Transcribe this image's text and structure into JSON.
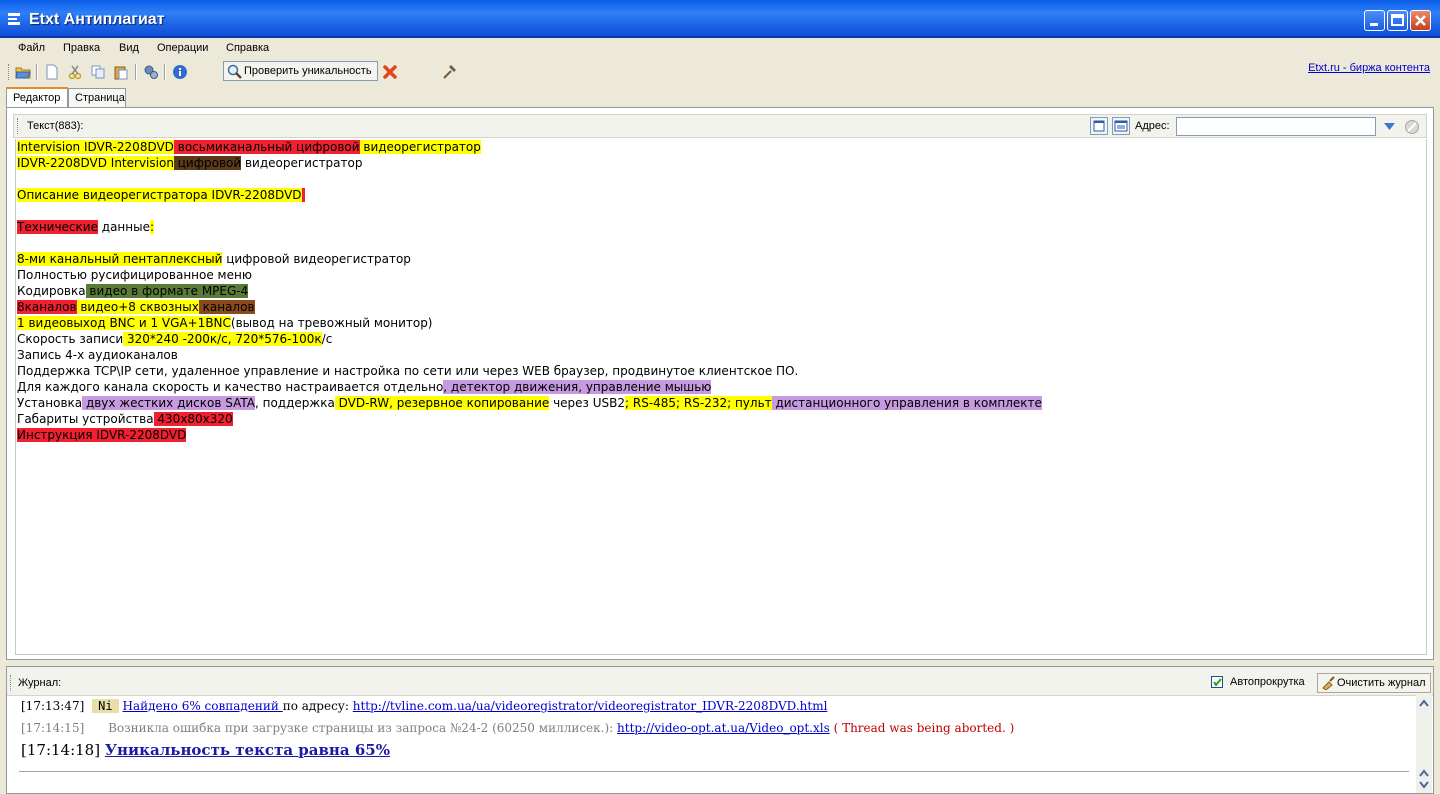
{
  "window": {
    "title": "Etxt Антиплагиат"
  },
  "menu": [
    "Файл",
    "Правка",
    "Вид",
    "Операции",
    "Справка"
  ],
  "toolbar": {
    "check_label": "Проверить уникальность",
    "link_label": "Etxt.ru - биржа контента"
  },
  "tabs": [
    "Редактор",
    "Страница"
  ],
  "editor": {
    "text_label": "Текст(883):",
    "address_label": "Адрес:",
    "address_value": "",
    "colors": {
      "yellow": "#FFFF00",
      "red": "#F02030",
      "brown": "#8B4A1C",
      "darkbrown": "#5A3A18",
      "green": "#5A7A38",
      "violet": "#C79AE0"
    },
    "lines": [
      [
        {
          "t": "Intervision IDVR-2208DVD",
          "c": "yellow"
        },
        {
          "t": " восьмиканальный цифровой",
          "c": "red"
        },
        {
          "t": " видеорегистратор",
          "c": "yellow"
        }
      ],
      [
        {
          "t": "IDVR-2208DVD Intervision",
          "c": "yellow"
        },
        {
          "t": " цифровой",
          "c": "darkbrown"
        },
        {
          "t": " видеорегистратор",
          "c": ""
        }
      ],
      [],
      [
        {
          "t": "Описание видеорегистратора IDVR-2208DVD",
          "c": "yellow"
        },
        {
          "t": " ",
          "c": "red"
        }
      ],
      [],
      [
        {
          "t": "Технические",
          "c": "red"
        },
        {
          "t": " данные",
          "c": ""
        },
        {
          "t": ":",
          "c": "yellow"
        }
      ],
      [],
      [
        {
          "t": "8-ми канальный пентаплексный",
          "c": "yellow"
        },
        {
          "t": " цифровой видеорегистратор",
          "c": ""
        }
      ],
      [
        {
          "t": "Полностью русифицированное меню",
          "c": ""
        }
      ],
      [
        {
          "t": "Кодировка",
          "c": ""
        },
        {
          "t": " видео в формате MPEG-4",
          "c": "green"
        }
      ],
      [
        {
          "t": "8каналов",
          "c": "red"
        },
        {
          "t": " видео+8 сквозных",
          "c": "yellow"
        },
        {
          "t": " каналов",
          "c": "brown"
        }
      ],
      [
        {
          "t": "1 видеовыход BNC и 1 VGA+1BNC",
          "c": "yellow"
        },
        {
          "t": "(вывод на тревожный монитор)",
          "c": ""
        }
      ],
      [
        {
          "t": "Скорость записи",
          "c": ""
        },
        {
          "t": " 320*240 -200к/с, 720*576-100к",
          "c": "yellow"
        },
        {
          "t": "/с",
          "c": ""
        }
      ],
      [
        {
          "t": "Запись 4-х аудиоканалов",
          "c": ""
        }
      ],
      [
        {
          "t": "Поддержка TCP\\IP сети, удаленное управление и настройка по сети или через WEB браузер, продвинутое клиентское ПО.",
          "c": ""
        }
      ],
      [
        {
          "t": "Для каждого канала скорость и качество настраивается отдельно",
          "c": ""
        },
        {
          "t": ", детектор движения, управление мышью",
          "c": "violet"
        }
      ],
      [
        {
          "t": "Установка",
          "c": ""
        },
        {
          "t": " двух жестких дисков SATA",
          "c": "violet"
        },
        {
          "t": ", поддержка",
          "c": ""
        },
        {
          "t": " DVD-RW, резервное копирование",
          "c": "yellow"
        },
        {
          "t": " через USB2",
          "c": ""
        },
        {
          "t": "; RS-485; RS-232; пульт",
          "c": "yellow"
        },
        {
          "t": " дистанционного управления в комплекте",
          "c": "violet"
        }
      ],
      [
        {
          "t": "Габариты устройства",
          "c": ""
        },
        {
          "t": " 430х80х320",
          "c": "red"
        }
      ],
      [
        {
          "t": "Инструкция IDVR-2208DVD",
          "c": "red"
        }
      ]
    ]
  },
  "journal": {
    "label": "Журнал:",
    "autoscroll_label": "Автопрокрутка",
    "autoscroll_checked": true,
    "clear_label": "Очистить журнал",
    "entries": [
      {
        "time": "[17:13:47]",
        "badge": "Ni",
        "link_text": "Найдено 6% совпадений ",
        "middle": "по адресу: ",
        "url": "http://tvline.com.ua/ua/videoregistrator/videoregistrator_IDVR-2208DVD.html"
      },
      {
        "time": "[17:14:15]",
        "message": "Возникла ошибка при загрузке страницы из запроса №24-2 (60250 миллисек.):",
        "url": "http://video-opt.at.ua/Video_opt.xls",
        "error": "( Thread was being aborted. )"
      },
      {
        "time": "[17:14:18]",
        "result": "Уникальность текста равна 65%"
      }
    ]
  }
}
